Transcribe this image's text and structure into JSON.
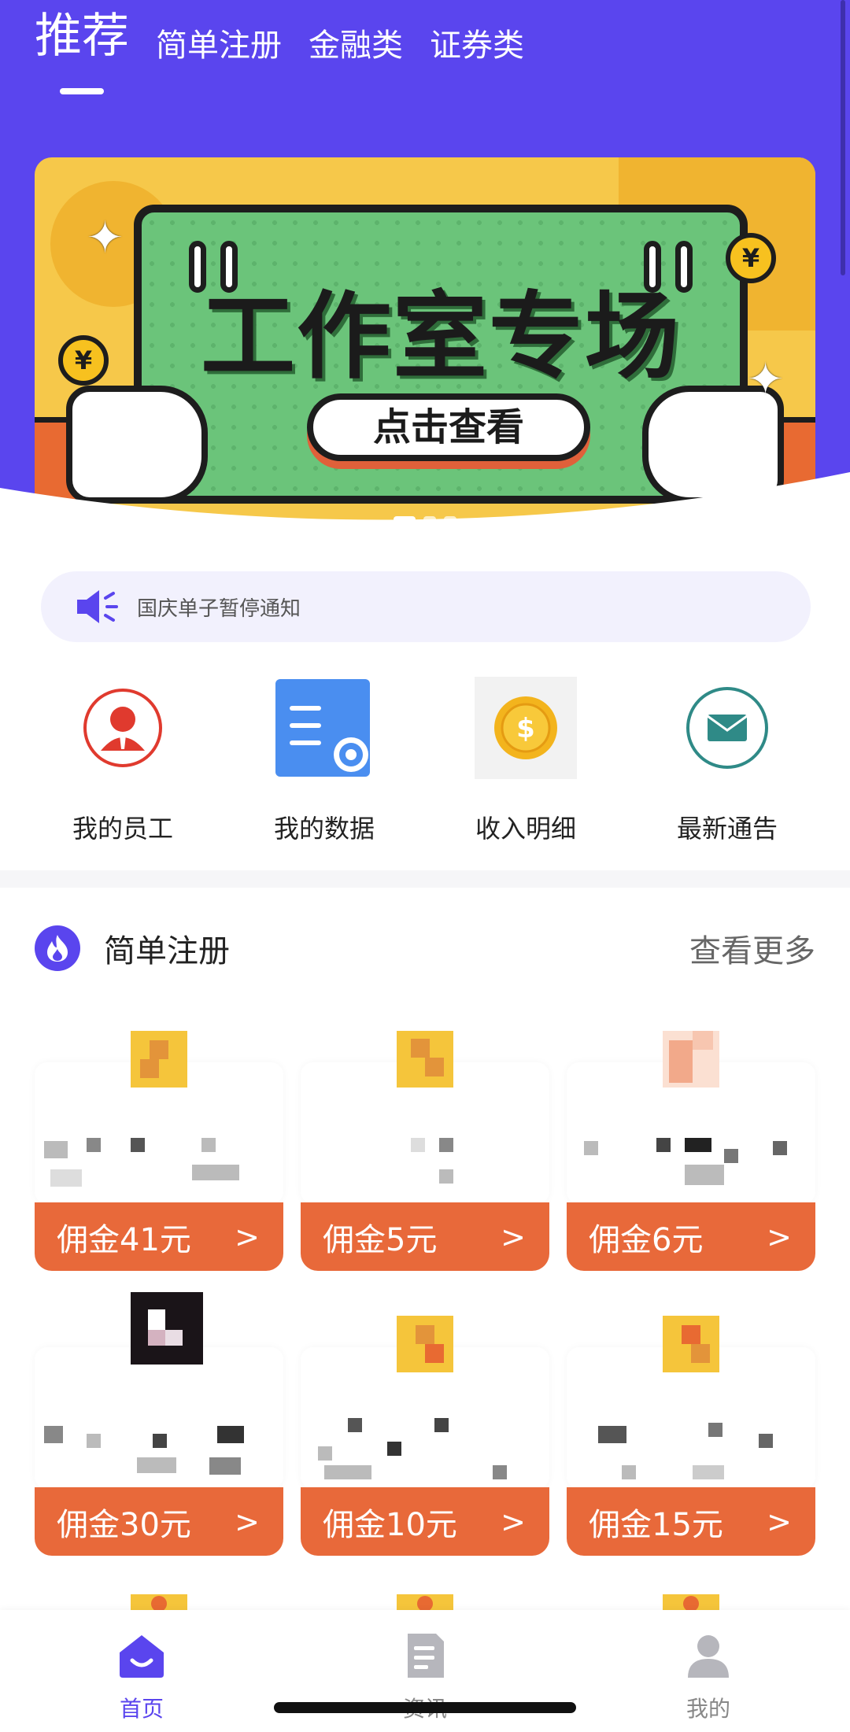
{
  "header": {
    "tabs": [
      {
        "label": "推荐",
        "active": true
      },
      {
        "label": "简单注册",
        "active": false
      },
      {
        "label": "金融类",
        "active": false
      },
      {
        "label": "证券类",
        "active": false
      }
    ]
  },
  "banner": {
    "title": "工作室专场",
    "button_label": "点击查看",
    "coin_symbol": "¥",
    "slide_count": 3,
    "active_slide": 1
  },
  "notice": {
    "icon": "speaker-icon",
    "text": "国庆单子暂停通知"
  },
  "shortcuts": [
    {
      "label": "我的员工",
      "icon": "employee-icon"
    },
    {
      "label": "我的数据",
      "icon": "data-settings-icon"
    },
    {
      "label": "收入明细",
      "icon": "gold-coin-icon"
    },
    {
      "label": "最新通告",
      "icon": "envelope-icon"
    }
  ],
  "section": {
    "title": "简单注册",
    "more_label": "查看更多",
    "icon": "flame-icon"
  },
  "products": [
    {
      "commission": "佣金41元",
      "arrow": ">"
    },
    {
      "commission": "佣金5元",
      "arrow": ">"
    },
    {
      "commission": "佣金6元",
      "arrow": ">"
    },
    {
      "commission": "佣金30元",
      "arrow": ">"
    },
    {
      "commission": "佣金10元",
      "arrow": ">"
    },
    {
      "commission": "佣金15元",
      "arrow": ">"
    }
  ],
  "bottom_nav": [
    {
      "label": "首页",
      "icon": "home-icon",
      "active": true
    },
    {
      "label": "资讯",
      "icon": "document-icon",
      "active": false
    },
    {
      "label": "我的",
      "icon": "user-icon",
      "active": false
    }
  ],
  "colors": {
    "brand": "#5a45ee",
    "commission": "#e8693a",
    "banner_yellow": "#f6c84a",
    "banner_green": "#6bc47a"
  }
}
